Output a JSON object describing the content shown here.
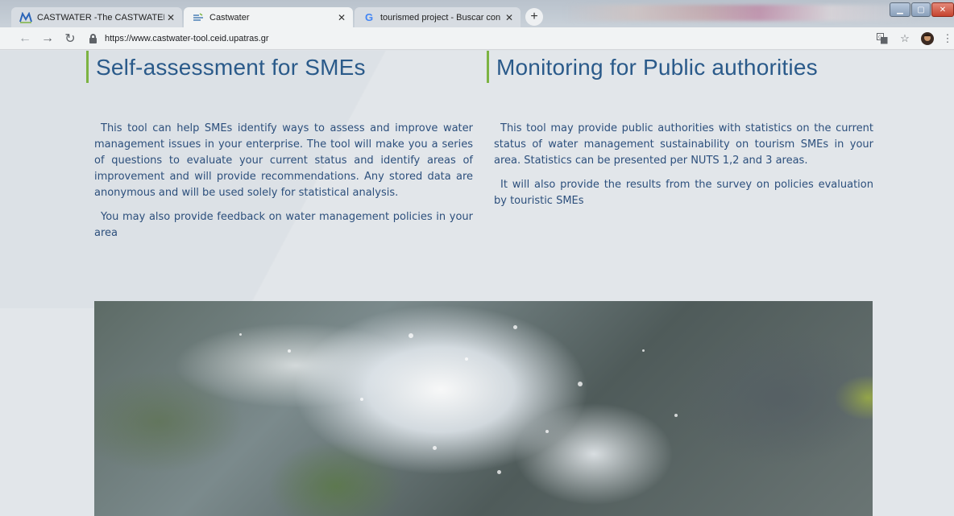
{
  "browser": {
    "tabs": [
      {
        "title": "CASTWATER -The CASTWATER t",
        "favicon": "castwater-logo-icon",
        "active": false
      },
      {
        "title": "Castwater",
        "favicon": "castwater-site-icon",
        "active": true
      },
      {
        "title": "tourismed project - Buscar con G",
        "favicon": "google-icon",
        "active": false
      }
    ],
    "new_tab": "+",
    "url": "https://www.castwater-tool.ceid.upatras.gr"
  },
  "page": {
    "left": {
      "title": "Self-assessment for SMEs",
      "paragraphs": [
        "This tool can help SMEs identify ways to assess and improve water management issues in your enterprise. The tool will make you a series of questions to evaluate your current status and identify areas of improvement and will provide recommendations. Any stored data are anonymous and will be used solely for statistical analysis.",
        "You may also provide feedback on water management policies in your area"
      ]
    },
    "right": {
      "title": "Monitoring for Public authorities",
      "paragraphs": [
        "This tool may provide public authorities with statistics on the current status of water management sustainability on tourism SMEs in your area. Statistics can be presented per NUTS 1,2 and 3 areas.",
        "It will also provide the results from the survey on policies evaluation by touristic SMEs"
      ]
    },
    "image": {
      "subject": "water splashing over mossy rocks"
    }
  },
  "colors": {
    "heading": "#2a5a8a",
    "text": "#2c4f7c",
    "accent": "#7cb342",
    "background": "#e2e6ea"
  }
}
